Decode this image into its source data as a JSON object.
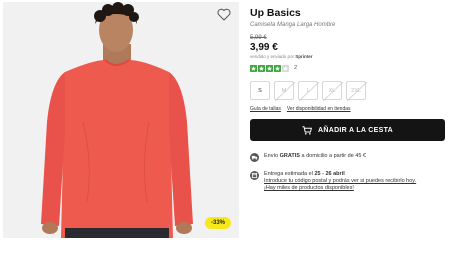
{
  "product": {
    "title": "Up Basics",
    "subtitle": "Camiseta Manga Larga Hombre",
    "old_price": "5,99 €",
    "price": "3,99 €",
    "seller_prefix": "vendido y enviado por",
    "seller_name": "Sprinter",
    "rating_stars": 4,
    "rating_count": "2",
    "discount_badge": "-33%"
  },
  "sizes": [
    {
      "label": "S",
      "available": true
    },
    {
      "label": "M",
      "available": false
    },
    {
      "label": "L",
      "available": false
    },
    {
      "label": "XL",
      "available": false
    },
    {
      "label": "2XL",
      "available": false
    }
  ],
  "links": {
    "size_guide": "Guía de tallas",
    "store_availability": "Ver disponibilidad en tiendas"
  },
  "cart_button": {
    "label": "AÑADIR A LA CESTA"
  },
  "shipping": {
    "prefix": "Envío ",
    "free": "GRATIS",
    "suffix": " a domicilio a partir de 45 €"
  },
  "delivery": {
    "prefix": "Entrega estimada el ",
    "dates": "25 - 26 abril",
    "line2": "Introduce tu código postal y podrás ver si puedes recibirlo hoy.",
    "line3": "¡Hay miles de productos disponibles!"
  },
  "colors": {
    "shirt": "#ef5a4f",
    "badge": "#f7e81b",
    "button": "#141414",
    "stars": "#3caa3c"
  },
  "icons": {
    "wishlist": "heart-outline-icon",
    "cart": "cart-icon",
    "shipping": "truck-icon",
    "delivery": "box-icon",
    "rating": "star-icon"
  }
}
